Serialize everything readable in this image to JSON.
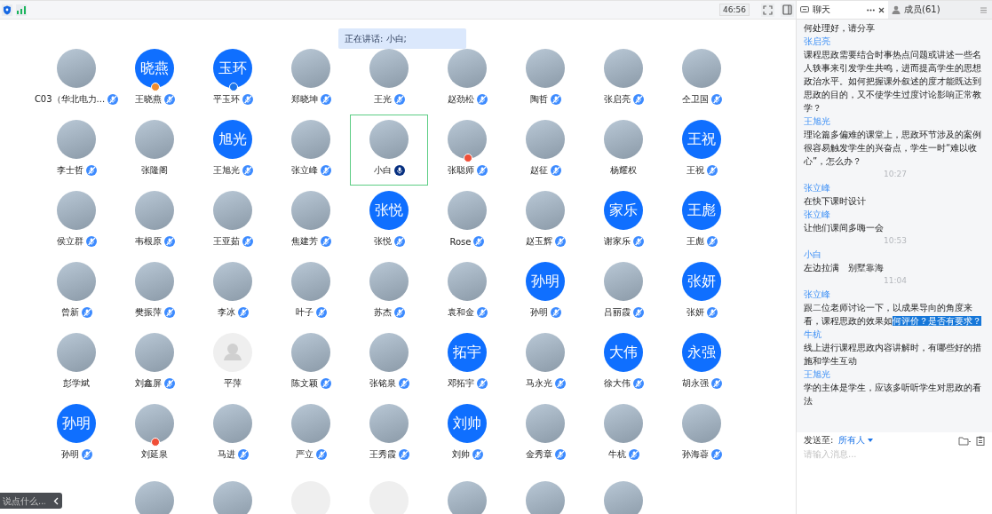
{
  "top_bar": {
    "timer": "46:56"
  },
  "speaking_banner": "正在讲话: 小白;",
  "participants": [
    {
      "name": "C03（华北电力...",
      "kind": "photo",
      "mic": true,
      "speaking": false,
      "selected": false
    },
    {
      "name": "王晓燕",
      "kind": "initials",
      "initials": "晓燕",
      "mic": true,
      "speaking": false,
      "badge": {
        "color": "#f08c2e"
      },
      "selected": false
    },
    {
      "name": "平玉环",
      "kind": "initials",
      "initials": "玉环",
      "mic": true,
      "speaking": false,
      "badge": {
        "color": "#1a73e8"
      },
      "selected": false
    },
    {
      "name": "郑晓坤",
      "kind": "photo",
      "mic": true,
      "speaking": false,
      "selected": false
    },
    {
      "name": "王光",
      "kind": "photo",
      "mic": true,
      "speaking": false,
      "selected": false
    },
    {
      "name": "赵劲松",
      "kind": "photo",
      "mic": true,
      "speaking": false,
      "selected": false
    },
    {
      "name": "陶哲",
      "kind": "photo",
      "mic": true,
      "speaking": false,
      "selected": false
    },
    {
      "name": "张启亮",
      "kind": "photo",
      "mic": true,
      "speaking": false,
      "selected": false
    },
    {
      "name": "仝卫国",
      "kind": "photo",
      "mic": true,
      "speaking": false,
      "selected": false
    },
    {
      "name": "李士哲",
      "kind": "photo",
      "mic": true,
      "speaking": false,
      "selected": false
    },
    {
      "name": "张隆阁",
      "kind": "photo",
      "mic": false,
      "speaking": false,
      "selected": false
    },
    {
      "name": "王旭光",
      "kind": "initials",
      "initials": "旭光",
      "mic": true,
      "speaking": false,
      "selected": false
    },
    {
      "name": "张立峰",
      "kind": "photo",
      "mic": true,
      "speaking": false,
      "selected": false
    },
    {
      "name": "小白",
      "kind": "photo",
      "mic": true,
      "speaking": true,
      "selected": true
    },
    {
      "name": "张聪师",
      "kind": "photo",
      "mic": true,
      "speaking": false,
      "badge": {
        "color": "#f04e37"
      },
      "selected": false
    },
    {
      "name": "赵征",
      "kind": "photo",
      "mic": true,
      "speaking": false,
      "selected": false
    },
    {
      "name": "杨耀权",
      "kind": "photo",
      "mic": false,
      "speaking": false,
      "selected": false
    },
    {
      "name": "王祝",
      "kind": "initials",
      "initials": "王祝",
      "mic": true,
      "speaking": false,
      "selected": false
    },
    {
      "name": "侯立群",
      "kind": "photo",
      "mic": true,
      "speaking": false,
      "selected": false
    },
    {
      "name": "韦根原",
      "kind": "photo",
      "mic": true,
      "speaking": false,
      "selected": false
    },
    {
      "name": "王亚茹",
      "kind": "photo",
      "mic": true,
      "speaking": false,
      "selected": false
    },
    {
      "name": "焦建芳",
      "kind": "photo",
      "mic": true,
      "speaking": false,
      "selected": false
    },
    {
      "name": "张悦",
      "kind": "initials",
      "initials": "张悦",
      "mic": true,
      "speaking": false,
      "selected": false
    },
    {
      "name": "Rose",
      "kind": "photo",
      "mic": true,
      "speaking": false,
      "selected": false
    },
    {
      "name": "赵玉辉",
      "kind": "photo",
      "mic": true,
      "speaking": false,
      "selected": false
    },
    {
      "name": "谢家乐",
      "kind": "initials",
      "initials": "家乐",
      "mic": true,
      "speaking": false,
      "selected": false
    },
    {
      "name": "王彪",
      "kind": "initials",
      "initials": "王彪",
      "mic": true,
      "speaking": false,
      "selected": false
    },
    {
      "name": "曾新",
      "kind": "photo",
      "mic": true,
      "speaking": false,
      "selected": false
    },
    {
      "name": "樊振萍",
      "kind": "photo",
      "mic": true,
      "speaking": false,
      "selected": false
    },
    {
      "name": "李冰",
      "kind": "photo",
      "mic": true,
      "speaking": false,
      "selected": false
    },
    {
      "name": "叶子",
      "kind": "photo",
      "mic": true,
      "speaking": false,
      "selected": false
    },
    {
      "name": "苏杰",
      "kind": "photo",
      "mic": true,
      "speaking": false,
      "selected": false
    },
    {
      "name": "袁和金",
      "kind": "photo",
      "mic": true,
      "speaking": false,
      "selected": false
    },
    {
      "name": "孙明",
      "kind": "initials",
      "initials": "孙明",
      "mic": true,
      "speaking": false,
      "selected": false
    },
    {
      "name": "吕丽霞",
      "kind": "photo",
      "mic": true,
      "speaking": false,
      "selected": false
    },
    {
      "name": "张妍",
      "kind": "initials",
      "initials": "张妍",
      "mic": true,
      "speaking": false,
      "selected": false
    },
    {
      "name": "彭学斌",
      "kind": "photo",
      "mic": false,
      "speaking": false,
      "selected": false
    },
    {
      "name": "刘鑫屏",
      "kind": "photo",
      "mic": true,
      "speaking": false,
      "selected": false
    },
    {
      "name": "平萍",
      "kind": "default",
      "mic": false,
      "speaking": false,
      "selected": false
    },
    {
      "name": "陈文颖",
      "kind": "photo",
      "mic": true,
      "speaking": false,
      "selected": false
    },
    {
      "name": "张铭泉",
      "kind": "photo",
      "mic": true,
      "speaking": false,
      "selected": false
    },
    {
      "name": "邓拓宇",
      "kind": "initials",
      "initials": "拓宇",
      "mic": true,
      "speaking": false,
      "selected": false
    },
    {
      "name": "马永光",
      "kind": "photo",
      "mic": true,
      "speaking": false,
      "selected": false
    },
    {
      "name": "徐大伟",
      "kind": "initials",
      "initials": "大伟",
      "mic": true,
      "speaking": false,
      "selected": false
    },
    {
      "name": "胡永强",
      "kind": "initials",
      "initials": "永强",
      "mic": true,
      "speaking": false,
      "selected": false
    },
    {
      "name": "孙明",
      "kind": "initials",
      "initials": "孙明",
      "mic": true,
      "speaking": false,
      "selected": false
    },
    {
      "name": "刘延泉",
      "kind": "photo",
      "mic": false,
      "speaking": false,
      "badge": {
        "color": "#f04e37"
      },
      "selected": false
    },
    {
      "name": "马进",
      "kind": "photo",
      "mic": true,
      "speaking": false,
      "selected": false
    },
    {
      "name": "严立",
      "kind": "photo",
      "mic": true,
      "speaking": false,
      "selected": false
    },
    {
      "name": "王秀霞",
      "kind": "photo",
      "mic": true,
      "speaking": false,
      "selected": false
    },
    {
      "name": "刘帅",
      "kind": "initials",
      "initials": "刘帅",
      "mic": true,
      "speaking": false,
      "selected": false
    },
    {
      "name": "金秀章",
      "kind": "photo",
      "mic": true,
      "speaking": false,
      "selected": false
    },
    {
      "name": "牛杭",
      "kind": "photo",
      "mic": true,
      "speaking": false,
      "selected": false
    },
    {
      "name": "孙海蓉",
      "kind": "photo",
      "mic": true,
      "speaking": false,
      "selected": false
    }
  ],
  "cut_off_row": [
    {
      "kind": "none"
    },
    {
      "kind": "photo"
    },
    {
      "kind": "photo"
    },
    {
      "kind": "default"
    },
    {
      "kind": "default"
    },
    {
      "kind": "photo"
    },
    {
      "kind": "photo"
    },
    {
      "kind": "photo"
    },
    {
      "kind": "none"
    }
  ],
  "comment_bar": {
    "placeholder": "说点什么..."
  },
  "tabs": [
    {
      "label": "聊天",
      "kind": "chat",
      "selected": true
    },
    {
      "label": "成员(61)",
      "kind": "members",
      "selected": false
    }
  ],
  "messages": [
    {
      "kind": "text",
      "text": "何处理好，请分享"
    },
    {
      "kind": "text",
      "sender": "张启亮",
      "text": "课程思政需要结合时事热点问题或讲述一些名人轶事来引发学生共鸣，进而提高学生的思想政治水平。如何把握课外叙述的度才能既达到思政的目的，又不使学生过度讨论影响正常教学？"
    },
    {
      "kind": "text",
      "sender": "王旭光",
      "text": "理论篇多偏难的课堂上，思政环节涉及的案例很容易触发学生的兴奋点，学生一时“难以收心”，怎么办？"
    },
    {
      "kind": "time",
      "text": "10:27"
    },
    {
      "kind": "text",
      "sender": "张立峰",
      "text": "在快下课时设计"
    },
    {
      "kind": "text",
      "sender": "张立峰",
      "text": "让他们课间多嗨一会"
    },
    {
      "kind": "time",
      "text": "10:53"
    },
    {
      "kind": "text",
      "sender": "小白",
      "text": "左边拉满　别墅靠海"
    },
    {
      "kind": "time",
      "text": "11:04"
    },
    {
      "kind": "text",
      "sender": "张立峰",
      "text": "跟二位老师讨论一下，以成果导向的角度来看，课程思政的效果如",
      "highlight": "何评价？是否有要求？"
    },
    {
      "kind": "text",
      "sender": "牛杭",
      "text": "线上进行课程思政内容讲解时，有哪些好的措施和学生互动"
    },
    {
      "kind": "text",
      "sender": "王旭光",
      "text": "学的主体是学生，应该多听听学生对思政的看法"
    }
  ],
  "composer": {
    "send_to_label": "发送至:",
    "recipient": "所有人",
    "placeholder": "请输入消息..."
  }
}
